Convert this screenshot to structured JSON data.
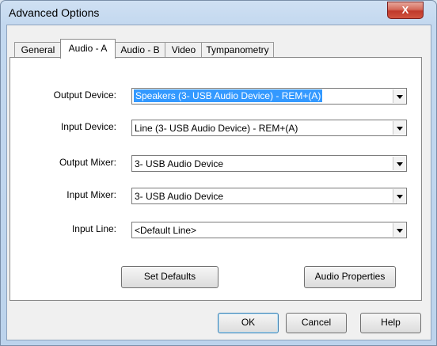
{
  "window": {
    "title": "Advanced Options",
    "close_glyph": "X"
  },
  "tabs": [
    {
      "label": "General"
    },
    {
      "label": "Audio - A"
    },
    {
      "label": "Audio - B"
    },
    {
      "label": "Video"
    },
    {
      "label": "Tympanometry"
    }
  ],
  "form": {
    "output_device": {
      "label": "Output Device:",
      "value": "Speakers (3- USB Audio Device) - REM+(A)"
    },
    "input_device": {
      "label": "Input Device:",
      "value": "Line (3- USB Audio Device) - REM+(A)"
    },
    "output_mixer": {
      "label": "Output Mixer:",
      "value": "3- USB Audio Device"
    },
    "input_mixer": {
      "label": "Input Mixer:",
      "value": "3- USB Audio Device"
    },
    "input_line": {
      "label": "Input Line:",
      "value": "<Default Line>"
    }
  },
  "buttons": {
    "set_defaults": "Set Defaults",
    "audio_properties": "Audio Properties",
    "ok": "OK",
    "cancel": "Cancel",
    "help": "Help"
  },
  "icons": {
    "close": "close-icon",
    "dropdown": "chevron-down-icon"
  }
}
